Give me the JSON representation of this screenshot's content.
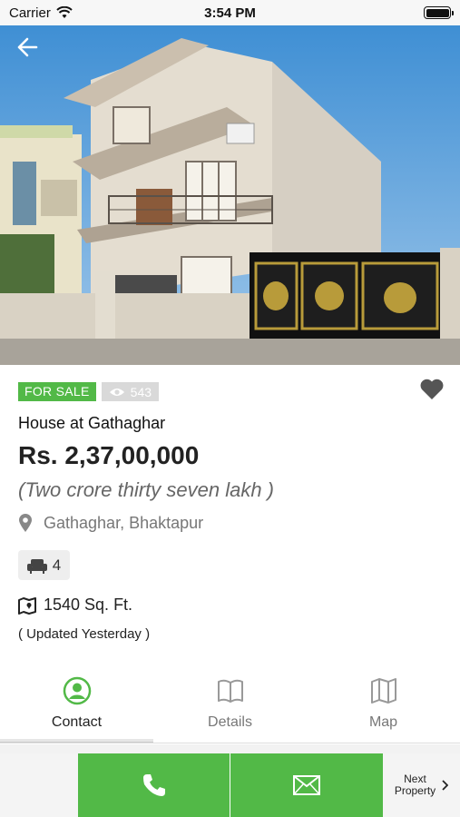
{
  "status_bar": {
    "carrier": "Carrier",
    "time": "3:54 PM"
  },
  "listing": {
    "badge_sale": "FOR SALE",
    "views": "543",
    "title": "House at Gathaghar",
    "price": "Rs. 2,37,00,000",
    "price_words": "(Two crore thirty seven lakh )",
    "location": "Gathaghar, Bhaktapur",
    "sofa_count": "4",
    "area": "1540 Sq. Ft.",
    "updated": "( Updated Yesterday )"
  },
  "tabs": [
    {
      "label": "Contact",
      "icon": "contact-icon",
      "active": true
    },
    {
      "label": "Details",
      "icon": "book-icon",
      "active": false
    },
    {
      "label": "Map",
      "icon": "map-icon",
      "active": false
    }
  ],
  "action_bar": {
    "call_icon": "phone-icon",
    "mail_icon": "mail-icon",
    "next_line1": "Next",
    "next_line2": "Property"
  },
  "colors": {
    "accent": "#52b947",
    "views_badge": "#d9d9d9",
    "muted_text": "#777777"
  }
}
